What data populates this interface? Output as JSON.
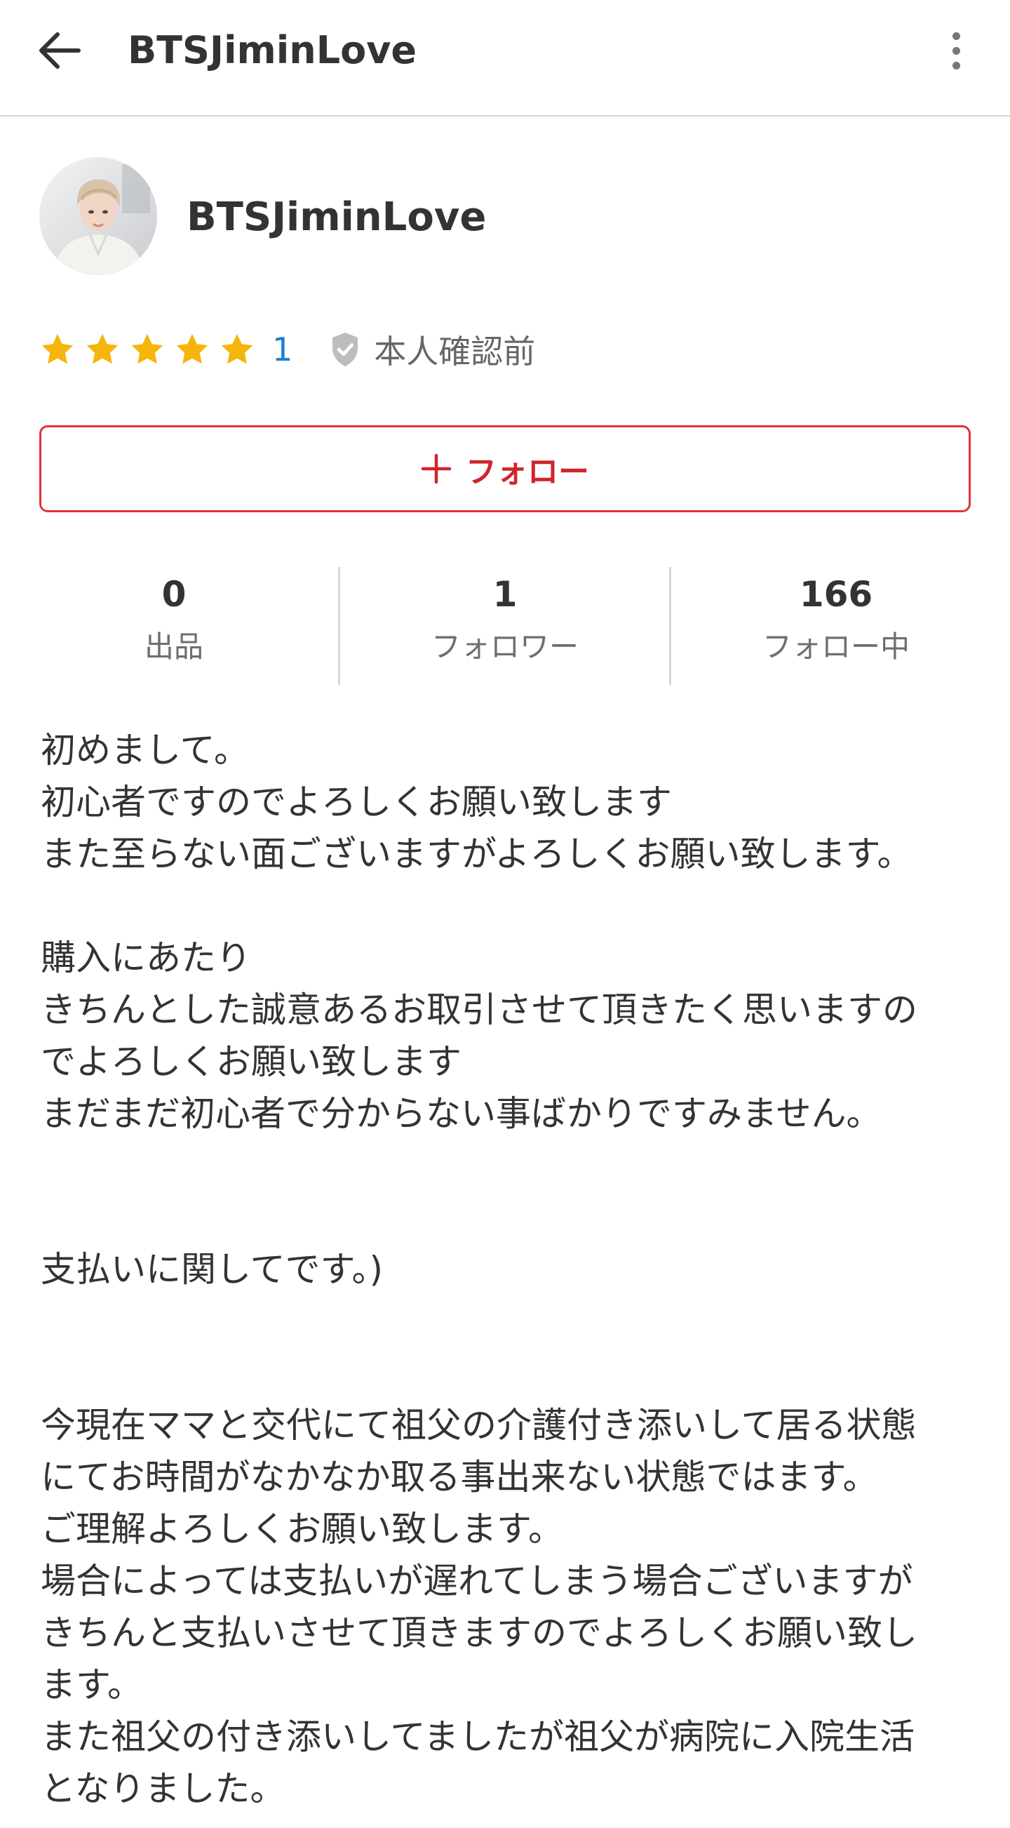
{
  "appbar": {
    "title": "BTSJiminLove",
    "back_icon": "arrow-left-icon",
    "more_icon": "more-vertical-icon"
  },
  "profile": {
    "name": "BTSJiminLove",
    "avatar": "avatar-photo"
  },
  "rating": {
    "stars": 5,
    "count": "1",
    "star_color": "#f5b50a",
    "verify_label": "本人確認前",
    "verify_icon": "shield-check-icon"
  },
  "follow_button": {
    "label": "フォロー",
    "icon": "plus-icon",
    "color": "#d1242c"
  },
  "stats": [
    {
      "value": "0",
      "label": "出品"
    },
    {
      "value": "1",
      "label": "フォロワー"
    },
    {
      "value": "166",
      "label": "フォロー中"
    }
  ],
  "bio": {
    "lines": [
      "初めまして。",
      "初心者ですのでよろしくお願い致します",
      "また至らない面ございますがよろしくお願い致します。",
      "",
      "購入にあたり",
      "きちんとした誠意あるお取引させて頂きたく思いますの",
      "でよろしくお願い致します",
      "まだまだ初心者で分からない事ばかりですみません。",
      "",
      "",
      "支払いに関してです。)",
      "",
      "",
      "今現在ママと交代にて祖父の介護付き添いして居る状態",
      "にてお時間がなかなか取る事出来ない状態ではます。",
      "ご理解よろしくお願い致します。",
      "場合によっては支払いが遅れてしまう場合ございますが",
      "きちんと支払いさせて頂きますのでよろしくお願い致し",
      "ます。",
      "また祖父の付き添いしてましたが祖父が病院に入院生活",
      "となりました。"
    ]
  }
}
